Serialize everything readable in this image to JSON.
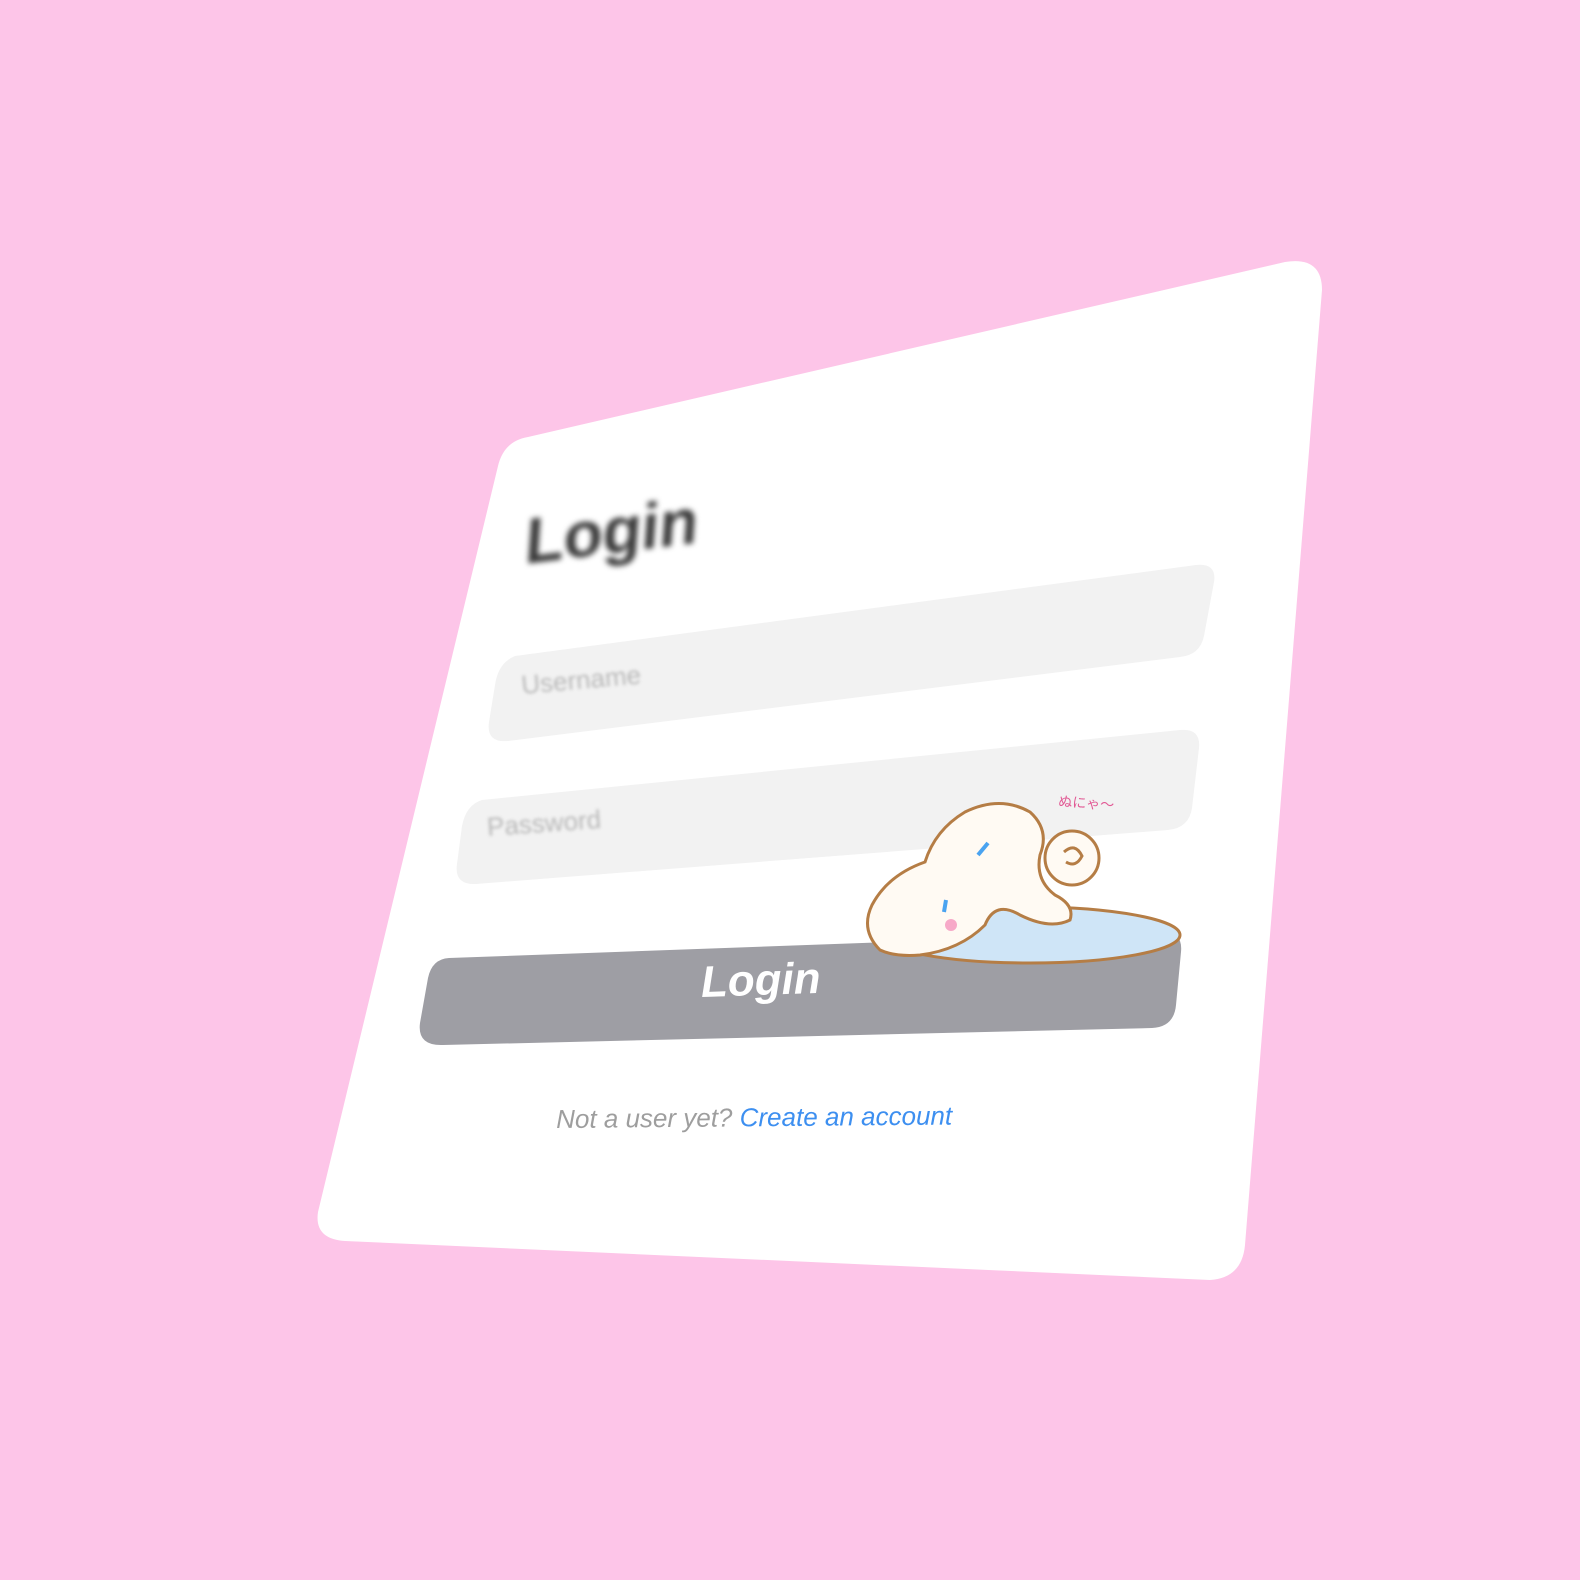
{
  "login_card": {
    "title": "Login",
    "username": {
      "placeholder": "Username",
      "value": ""
    },
    "password": {
      "placeholder": "Password",
      "value": ""
    },
    "submit_label": "Login",
    "signup_prompt": "Not a user yet?",
    "signup_link": "Create an account"
  },
  "sticker": {
    "caption": "ぬにゃ〜",
    "icon": "crying-dog-sticker"
  },
  "colors": {
    "background": "#fdc5e8",
    "card": "#ffffff",
    "input_fill": "#f2f2f2",
    "button": "#9e9ea4",
    "link": "#3d8ff0",
    "sticker_outline": "#b57d45",
    "puddle": "#cfe5f7"
  }
}
